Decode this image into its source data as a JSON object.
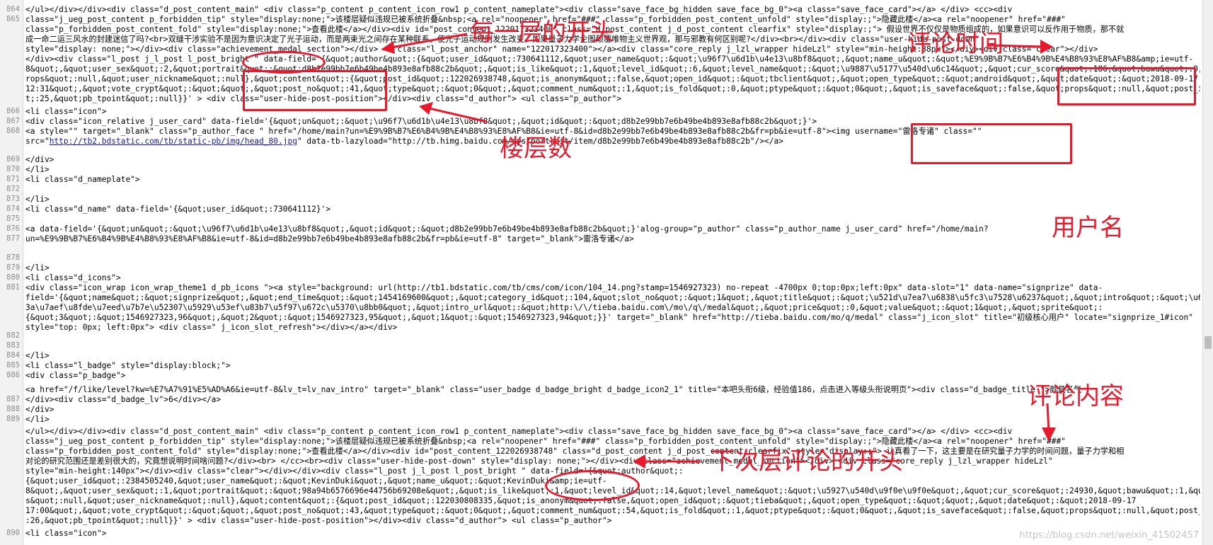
{
  "line_numbers": [
    "864",
    "865",
    "",
    "",
    "",
    "",
    "",
    "",
    "",
    "",
    "866",
    "867",
    "868",
    "",
    "869",
    "870",
    "871",
    "872",
    "873",
    "874",
    "875",
    "876",
    "877",
    "",
    "878",
    "879",
    "880",
    "881",
    "",
    "",
    "",
    "",
    "882",
    "883",
    "884",
    "885",
    "886",
    "",
    "887",
    "888",
    "889",
    "",
    "",
    "",
    "",
    "",
    "",
    "",
    "",
    "890"
  ],
  "code": {
    "l864": "        </ul></div></div><div  class=\"d_post_content_main\"          <div class=\"p_content  p_content_icon_row1 p_content_nameplate\"><div class=\"save_face_bg_hidden save_face_bg_0\"><a class=\"save_face_card\"></a>        </div>        <cc><div",
    "l865a": "class=\"j_ueg_post_content p_forbidden_tip\" style=\"display:none;\">该楼层疑似违规已被系统折叠&nbsp;<a rel=\"noopener\" href=\"###\" class=\"p_forbidden_post_content_unfold\" style=\"display:;\">隐藏此楼</a><a rel=\"noopener\" href=\"###\"",
    "l865b": "class=\"p_forbidden_post_content_fold\" style=\"display:none;\">查看此楼</a></div><div id=\"post_content_122017323400\" class=\"d_post_content j_d_post_content  clearfix\" style=\"display:;\">        假设世界不仅仅是物质组成的，如果意识可以反作用于物质，那不就",
    "l865c": "成一命二运三风水的封建迷信了吗?<br>双缝干涉实验不是因为意识决定了光子运动，而是两束光之间存在某种联系，使光子运动规则发生改变。如果量子力学企图颠覆唯物主义世界观，那与邪教有何区别呢?</div><br></div><div class=\"user-hide-post-down\"",
    "l865d": "style=\"display: none;\"></div><div class=\"achievement_medal_section\"></div>    <a class=\"l_post_anchor\" name=\"122017323400\"></a><div class=\"core_reply j_lzl_wrapper hideLzl\" style=\"min-height:38px\"></div><div class=\"clear\"></div>",
    "l865e": "</div><div class=\"l_post j_l_post l_post_bright  \" data-field='{&quot;author&quot;:{&quot;user_id&quot;:730641112,&quot;user_name&quot;:&quot;\\u96f7\\u6d1b\\u4e13\\u8bf8&quot;,&quot;name_u&quot;:&quot;%E9%9B%B7%E6%B4%9B%E4%B8%93%E8%AF%B8&amp;ie=utf-",
    "l865f": "8&quot;,&quot;user_sex&quot;:2,&quot;portrait&quot;:&quot;d8b2e99bb7e6b49be4b893e8afb88c2b&quot;,&quot;is_like&quot;:1,&quot;level_id&quot;:6,&quot;level_name&quot;:&quot;\\u9887\\u5177\\u540d\\u6c14&quot;,&quot;cur_score&quot;:186,&quot;bawu&quot;:0,&quot;p",
    "l865g": "rops&quot;:null,&quot;user_nickname&quot;:null},&quot;content&quot;:{&quot;post_id&quot;:122026938748,&quot;is_anonym&quot;:false,&quot;open_id&quot;:&quot;tbclient&quot;,&quot;open_type&quot;:&quot;android&quot;,&quot;date&quot;:&quot;2018-09-17",
    "l865h": "12:31&quot;,&quot;vote_crypt&quot;:&quot;&quot;,&quot;post_no&quot;:41,&quot;type&quot;:&quot;0&quot;,&quot;comment_num&quot;:1,&quot;is_fold&quot;:0,&quot;ptype&quot;:&quot;0&quot;,&quot;is_saveface&quot;:false,&quot;props&quot;:null,&quot;post_index&quot;",
    "l865i": "t;:25,&quot;pb_tpoint&quot;:null}}' >            <div class=\"user-hide-post-position\"></div><div class=\"d_author\">          <ul class=\"p_author\">",
    "l866": "            <li class=\"icon\">",
    "l867": "                <div class=\"icon_relative j_user_card\" data-field='{&quot;un&quot;:&quot;\\u96f7\\u6d1b\\u4e13\\u8bf8&quot;,&quot;id&quot;:&quot;d8b2e99bb7e6b49be4b893e8afb88c2b&quot;}'>",
    "l868a": "                    <a style=\"\" target=\"_blank\" class=\"p_author_face \" href=\"/home/main?un=%E9%9B%B7%E6%B4%9B%E4%B8%93%E8%AF%B8&ie=utf-8&id=d8b2e99bb7e6b49be4b893e8afb88c2b&fr=pb&ie=utf-8\"><img username=\"雷洛专诸\" class=\"\"",
    "l868b_pre": "src=\"",
    "l868b_url": "http://tb2.bdstatic.com/tb/static-pb/img/head_80.jpg",
    "l868b_post": "\" data-tb-lazyload=\"http://tb.himg.baidu.com/sys/portrait/item/d8b2e99bb7e6b49be4b893e8afb88c2b\"/></a>",
    "l869": "                </div>",
    "l870": "            </li>",
    "l871": "            <li class=\"d_nameplate\">",
    "l873": "            </li>",
    "l874": "            <li class=\"d_name\" data-field='{&quot;user_id&quot;:730641112}'>",
    "l876": "                <a data-field='{&quot;un&quot;:&quot;\\u96f7\\u6d1b\\u4e13\\u8bf8&quot;,&quot;id&quot;:&quot;d8b2e99bb7e6b49be4b893e8afb88c2b&quot;}'alog-group=\"p_author\" class=\"p_author_name j_user_card\" href=\"/home/main?",
    "l877": "un=%E9%9B%B7%E6%B4%9B%E4%B8%93%E8%AF%B8&ie=utf-8&id=d8b2e99bb7e6b49be4b893e8afb88c2b&fr=pb&ie=utf-8\" target=\"_blank\">雷洛专诸</a>",
    "l879": "            </li>",
    "l880": "                            <li class=\"d_icons\">",
    "l881a": "            <div class=\"icon_wrap  icon_wrap_theme1 d_pb_icons \"><a style=\"background: url(http://tb1.bdstatic.com/tb/cms/com/icon/104_14.png?stamp=1546927323) no-repeat -4700px  0;top:0px;left:0px\" data-slot=\"1\"  data-name=\"signprize\" data-",
    "l881b": "field='{&quot;name&quot;:&quot;signprize&quot;,&quot;end_time&quot;:&quot;1454169600&quot;,&quot;category_id&quot;:104,&quot;slot_no&quot;:&quot;1&quot;,&quot;title&quot;:&quot;\\u521d\\u7ea7\\u6838\\u5fc3\\u7528\\u6237&quot;,&quot;intro&quot;:&quot;\\u624b\\u67",
    "l881c": "3a\\u7aef\\u8fde\\u7eed\\u7b7e\\u52307\\u5929\\u53ef\\u83b7\\u5f97\\u672c\\u5370\\u8bb0&quot;,&quot;intro_url&quot;:&quot;http:\\/\\/tieba.baidu.com\\/mo\\/q\\/medal&quot;,&quot;price&quot;:0,&quot;value&quot;:&quot;1&quot;,&quot;sprite&quot;:",
    "l881d": "{&quot;3&quot;:&quot;1546927323,96&quot;,&quot;2&quot;:&quot;1546927323,95&quot;,&quot;1&quot;:&quot;1546927323,94&quot;}}' target=\"_blank\"   href=\"http://tieba.baidu.com/mo/q/medal\"  class=\"j_icon_slot\"  title=\"初级核心用户\"  locate=\"signprize_1#icon\"",
    "l881e": "style=\"top: 0px; left:0px\">  <div class=\" j_icon_slot_refresh\"></div></a></div>",
    "l883": "        </li>",
    "l884": "            <li class=\"l_badge\" style=\"display:block;\">",
    "l885": "                <div class=\"p_badge\">",
    "l886a": "                    <a href=\"/f/like/level?kw=%E7%A7%91%E5%AD%A6&ie=utf-8&lv_t=lv_nav_intro\" target=\"_blank\" class=\"user_badge d_badge_bright d_badge_icon2_1\" title=\"本吧头衔6级，经验值186，点击进入等级头衔说明页\"><div class=\"d_badge_title \">颇具名气",
    "l886b": "</div><div class=\"d_badge_lv\">6</div></a>",
    "l887": "                </div>",
    "l888": "            </li>",
    "l889a": "        </ul></div></div><div  class=\"d_post_content_main\"          <div class=\"p_content  p_content_icon_row1 p_content_nameplate\"><div class=\"save_face_bg_hidden save_face_bg_0\"><a class=\"save_face_card\"></a>        </div>        <cc><div",
    "l889b": "class=\"j_ueg_post_content p_forbidden_tip\" style=\"display:none;\">该楼层疑似违规已被系统折叠&nbsp;<a rel=\"noopener\" href=\"###\" class=\"p_forbidden_post_content_unfold\" style=\"display:;\">隐藏此楼</a><a rel=\"noopener\" href=\"###\"",
    "l889c": "class=\"p_forbidden_post_content_fold\" style=\"display:none;\">查看此楼</a></div><div id=\"post_content_122026938748\" class=\"d_post_content j_d_post_content  clearfix\" style=\"display:;\">        认真看了一下，这主要是在研究量子力学的时间问题，量子力学和相",
    "l889d": "对论的研究范围还是差别很大的，究竟想说明时间啥问题?</div><br>          </cc><br><div class=\"user-hide-post-down\" style=\"display: none;\"></div><div class=\"achievement_medal_section\"></div>   <div class=\"core_reply j_lzl_wrapper hideLzl\"",
    "l889e": "style=\"min-height:140px\"></div><div class=\"clear\"></div></div><div class=\"l_post j_l_post l_post_bright  \" data-field='{&quot;author&quot;:",
    "l889f": "{&quot;user_id&quot;:2384505240,&quot;user_name&quot;:&quot;KevinDuki&quot;,&quot;name_u&quot;:&quot;KevinDuki&amp;ie=utf-",
    "l889g": "8&quot;,&quot;user_sex&quot;:1,&quot;portrait&quot;:&quot;98a94b6576696e44756b69208e&quot;,&quot;is_like&quot;:1,&quot;level_id&quot;:14,&quot;level_name&quot;:&quot;\\u5927\\u540d\\u9f0e\\u9f0e&quot;,&quot;cur_score&quot;:24930,&quot;bawu&quot;:1,&quot;prop",
    "l889h": "s&quot;:null,&quot;user_nickname&quot;:null},&quot;content&quot;:{&quot;post_id&quot;:122030808335,&quot;is_anonym&quot;:false,&quot;open_id&quot;:&quot;tieba&quot;,&quot;open_type&quot;:&quot;&quot;,&quot;date&quot;:&quot;2018-09-17",
    "l889i": "17:00&quot;,&quot;vote_crypt&quot;:&quot;&quot;,&quot;post_no&quot;:43,&quot;type&quot;:&quot;0&quot;,&quot;comment_num&quot;:54,&quot;is_fold&quot;:1,&quot;ptype&quot;:&quot;0&quot;,&quot;is_saveface&quot;:false,&quot;props&quot;:null,&quot;post_index&quot;",
    "l889j": ":26,&quot;pb_tpoint&quot;:null}}' >            <div class=\"user-hide-post-position\"></div><div class=\"d_author\">          <ul class=\"p_author\">",
    "l890": "            <li class=\"icon\">"
  },
  "annotations": {
    "floor_start": "每一层的开头",
    "floor_number": "楼层数",
    "comment_time": "评论时间",
    "username": "用户名",
    "comment_content": "评论内容",
    "next_floor_start": "下次层评论的开头"
  },
  "watermark": "https://blog.csdn.net/weixin_41502457",
  "colors": {
    "annotation_red": "#e8192c",
    "tag": "#881280",
    "attribute": "#994500",
    "value": "#1a1aa6"
  }
}
